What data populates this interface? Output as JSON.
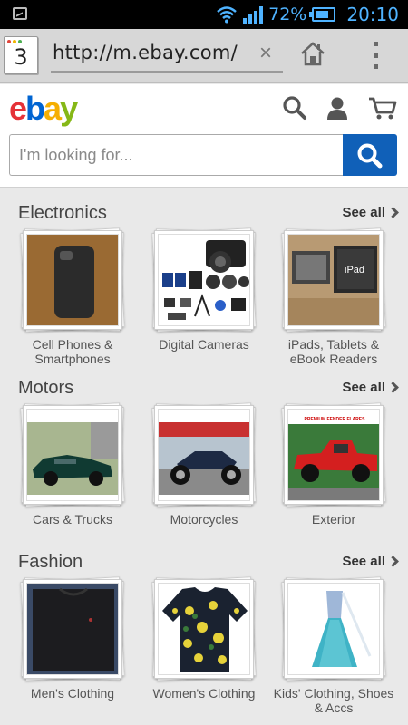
{
  "status_bar": {
    "battery_percent": "72%",
    "time": "20:10",
    "accent_color": "#4fb3ff"
  },
  "browser": {
    "tab_count": "3",
    "url": "http://m.ebay.com/",
    "clear_glyph": "×",
    "home_icon": "home-icon",
    "menu_icon": "overflow-menu-icon"
  },
  "header": {
    "logo": {
      "e": "e",
      "b": "b",
      "a": "a",
      "y": "y"
    },
    "search_placeholder": "I'm looking for...",
    "brand_blue": "#1060b8",
    "icons": [
      "search-icon",
      "user-icon",
      "cart-icon"
    ]
  },
  "sections": [
    {
      "title": "Electronics",
      "see_all": "See all",
      "items": [
        {
          "label_1": "Cell Phones &",
          "label_2": "Smartphones"
        },
        {
          "label_1": "Digital Cameras",
          "label_2": ""
        },
        {
          "label_1": "iPads, Tablets &",
          "label_2": "eBook Readers"
        }
      ]
    },
    {
      "title": "Motors",
      "see_all": "See all",
      "items": [
        {
          "label_1": "Cars & Trucks",
          "label_2": ""
        },
        {
          "label_1": "Motorcycles",
          "label_2": ""
        },
        {
          "label_1": "Exterior",
          "label_2": ""
        }
      ]
    },
    {
      "title": "Fashion",
      "see_all": "See all",
      "items": [
        {
          "label_1": "Men's Clothing",
          "label_2": ""
        },
        {
          "label_1": "Women's Clothing",
          "label_2": ""
        },
        {
          "label_1": "Kids' Clothing, Shoes",
          "label_2": "& Accs"
        }
      ]
    }
  ],
  "exterior_banner_text": "PREMIUM FENDER FLARES",
  "ipad_screen_text": "iPad"
}
